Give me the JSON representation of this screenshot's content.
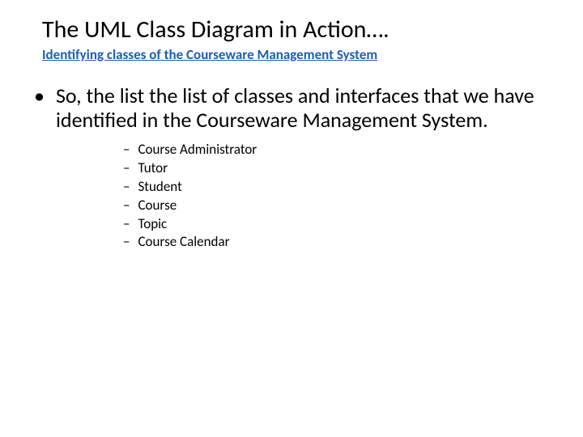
{
  "title": "The UML Class Diagram in Action….",
  "subtitle": "Identifying classes of the Courseware Management System",
  "bullet_marker": "•",
  "main_text": "So, the list the list of classes and interfaces that we have identified in the Courseware Management System.",
  "dash": "–",
  "items": {
    "i0": "Course Administrator",
    "i1": "Tutor",
    "i2": "Student",
    "i3": "Course",
    "i4": "Topic",
    "i5": "Course Calendar"
  }
}
